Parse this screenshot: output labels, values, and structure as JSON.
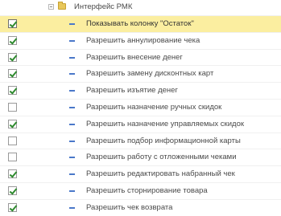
{
  "group": {
    "label": "Интерфейс РМК"
  },
  "rows": [
    {
      "label": "Показывать колонку \"Остаток\"",
      "checked": true,
      "selected": true
    },
    {
      "label": "Разрешить аннулирование чека",
      "checked": true
    },
    {
      "label": "Разрешить внесение денег",
      "checked": true
    },
    {
      "label": "Разрешить замену дисконтных карт",
      "checked": true
    },
    {
      "label": "Разрешить изъятие денег",
      "checked": true
    },
    {
      "label": "Разрешить назначение ручных скидок",
      "checked": false
    },
    {
      "label": "Разрешить назначение управляемых скидок",
      "checked": true
    },
    {
      "label": "Разрешить подбор информационной карты",
      "checked": false
    },
    {
      "label": "Разрешить работу с отложенными чеками",
      "checked": false
    },
    {
      "label": "Разрешить редактировать набранный чек",
      "checked": true
    },
    {
      "label": "Разрешить сторнирование товара",
      "checked": true
    },
    {
      "label": "Разрешить чек возврата",
      "checked": true
    }
  ]
}
